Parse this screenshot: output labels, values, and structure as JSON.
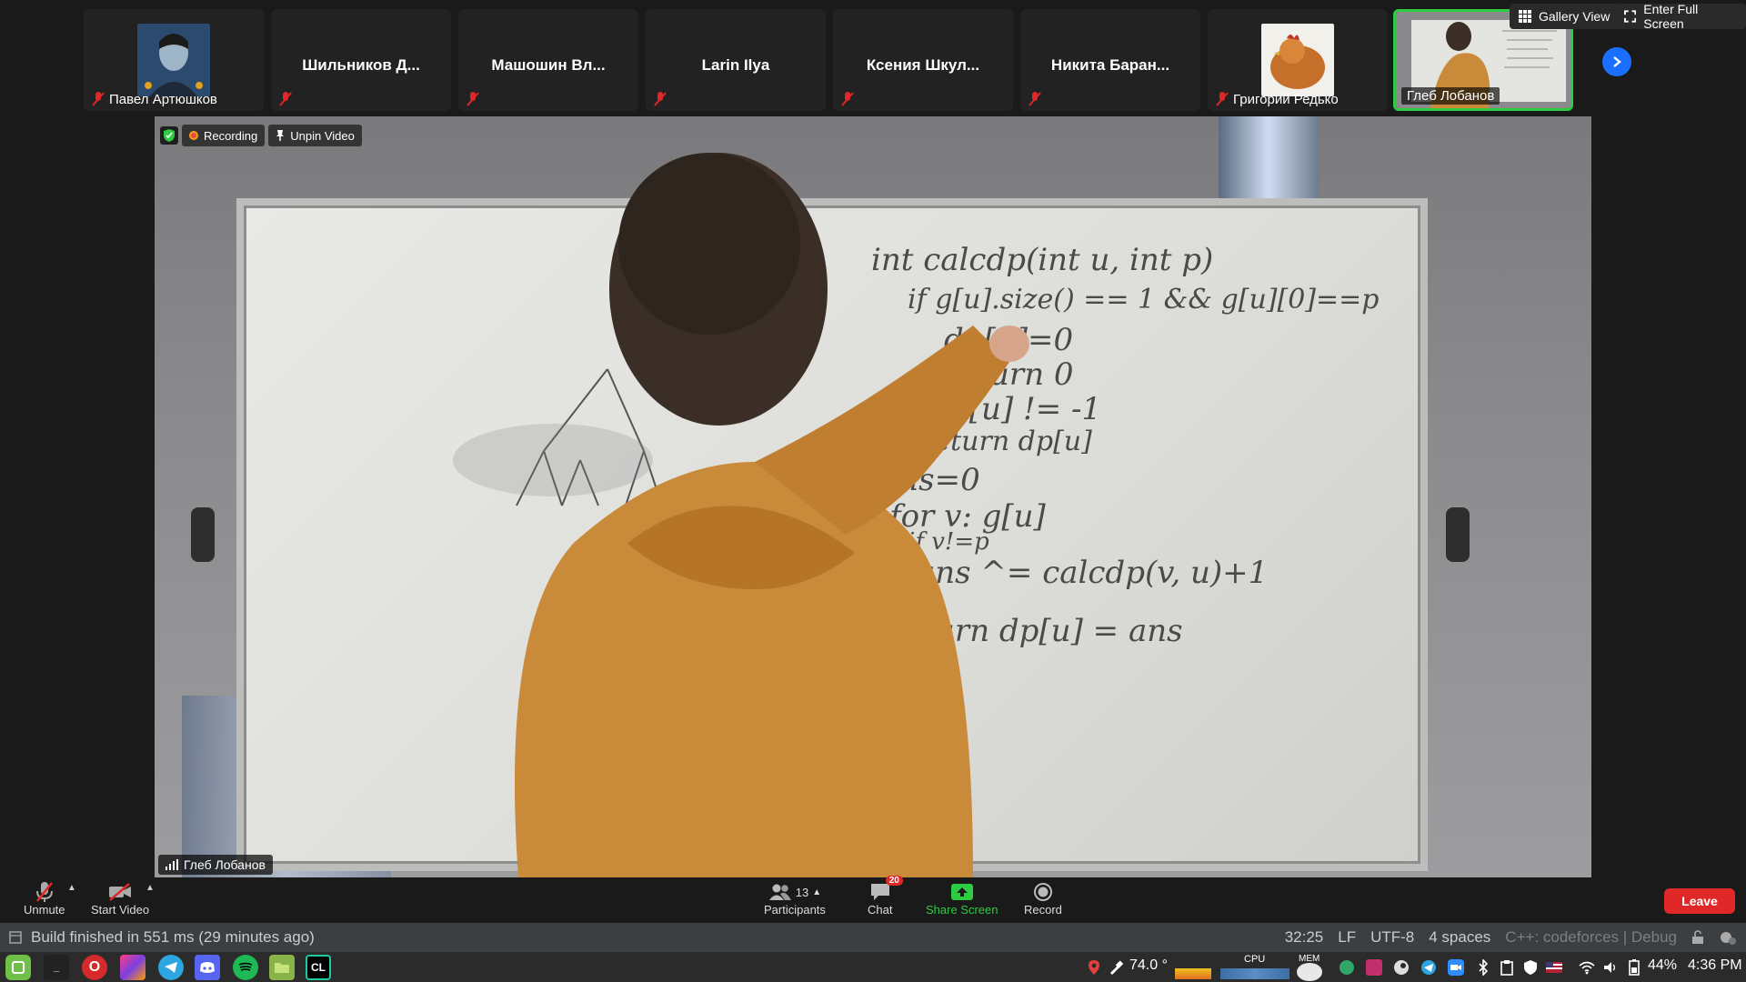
{
  "participants": [
    {
      "name": "Павел Артюшков",
      "has_avatar": true,
      "avatar": "portrait-avatar",
      "muted": true
    },
    {
      "name": "Шильников Д...",
      "has_avatar": false,
      "muted": true
    },
    {
      "name": "Машошин Вл...",
      "has_avatar": false,
      "muted": true
    },
    {
      "name": "Larin Ilya",
      "has_avatar": false,
      "muted": true
    },
    {
      "name": "Ксения Шкул...",
      "has_avatar": false,
      "muted": true
    },
    {
      "name": "Никита Баран...",
      "has_avatar": false,
      "muted": true
    },
    {
      "name": "Григорий Редько",
      "has_avatar": true,
      "avatar": "chicken-avatar",
      "muted": true
    },
    {
      "name": "Глеб Лобанов",
      "has_avatar": true,
      "avatar": "video-thumbnail",
      "muted": false,
      "active": true
    }
  ],
  "top_controls": {
    "gallery_view": "Gallery View",
    "enter_full_screen": "Enter Full Screen"
  },
  "video_overlay": {
    "recording": "Recording",
    "unpin_video": "Unpin Video",
    "speaker": "Глеб Лобанов"
  },
  "whiteboard": {
    "lines": [
      "int calcdp(int u, int p)",
      "if g[u].size() == 1 && g[u][0]==p",
      "dp[u]=0",
      "return 0",
      "if dp[u] != -1",
      "return dp[u]",
      "ans=0",
      "for v: g[u]",
      "if v!=p",
      "ans ^= calcdp(v, u)+1",
      "return dp[u] = ans"
    ]
  },
  "zoom_bar": {
    "unmute": "Unmute",
    "start_video": "Start Video",
    "participants": "Participants",
    "participants_count": "13",
    "chat": "Chat",
    "chat_badge": "20",
    "share_screen": "Share Screen",
    "record": "Record",
    "leave": "Leave"
  },
  "ide_status": {
    "message": "Build finished in 551 ms (29 minutes ago)",
    "position": "32:25",
    "line_ending": "LF",
    "encoding": "UTF-8",
    "indent": "4 spaces",
    "config": "C++: codeforces | Debug"
  },
  "taskbar": {
    "temperature": "74.0 °",
    "cpu_label": "CPU",
    "mem_label": "MEM",
    "battery": "44%",
    "time": "4:36 PM"
  },
  "colors": {
    "accent_blue": "#1b6fff",
    "active_green": "#2ecc40",
    "leave_red": "#e02828",
    "shirt_orange": "#c98a3a"
  }
}
